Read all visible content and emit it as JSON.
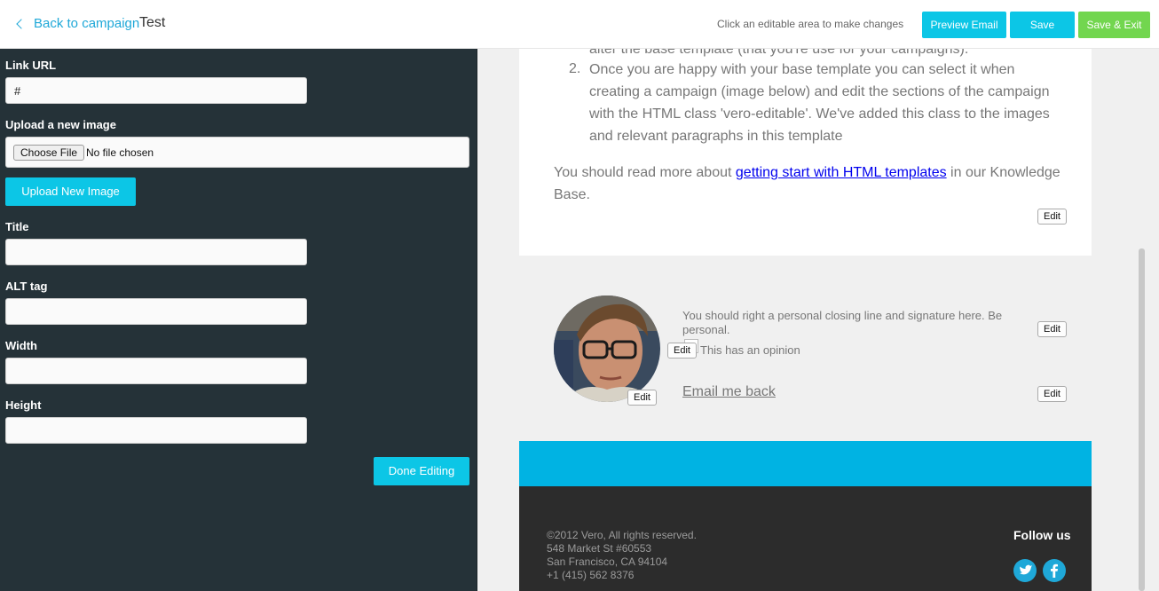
{
  "header": {
    "back_label": "Back to campaign",
    "campaign_name": "Test",
    "hint": "Click an editable area to make changes",
    "preview_label": "Preview Email",
    "save_label": "Save",
    "save_exit_label": "Save & Exit"
  },
  "panel": {
    "link_url_label": "Link URL",
    "link_url_value": "#",
    "upload_label": "Upload a new image",
    "choose_file_label": "Choose File",
    "no_file_label": "No file chosen",
    "upload_button": "Upload New Image",
    "title_label": "Title",
    "alt_label": "ALT tag",
    "width_label": "Width",
    "height_label": "Height",
    "done_label": "Done Editing"
  },
  "email": {
    "clipped_line": "alter the base template (that you're use for your campaigns).",
    "list_number": "2.",
    "list_item": "Once you are happy with your base template you can select it when creating a campaign (image below) and edit the sections of the campaign with the HTML class 'vero-editable'. We've added this class to the images and relevant paragraphs in this template",
    "para_before": "You should read more about ",
    "para_link": "getting start with HTML templates",
    "para_after": " in our Knowledge Base.",
    "edit_label": "Edit",
    "closing_line": "You should right a personal closing line and signature here. Be personal.",
    "opinion": "This has an opinion",
    "email_me": "Email me back",
    "footer": {
      "copyright": "©2012 Vero, All rights reserved.",
      "street": "548 Market St #60553",
      "city": "San Francisco, CA 94104",
      "phone": "+1 (415) 562 8376",
      "follow": "Follow us"
    }
  },
  "colors": {
    "accent": "#0cc6e6",
    "save_exit": "#72d64f",
    "panel_bg": "#253238",
    "band": "#00b3e3",
    "footer_bg": "#2c2c2c"
  }
}
